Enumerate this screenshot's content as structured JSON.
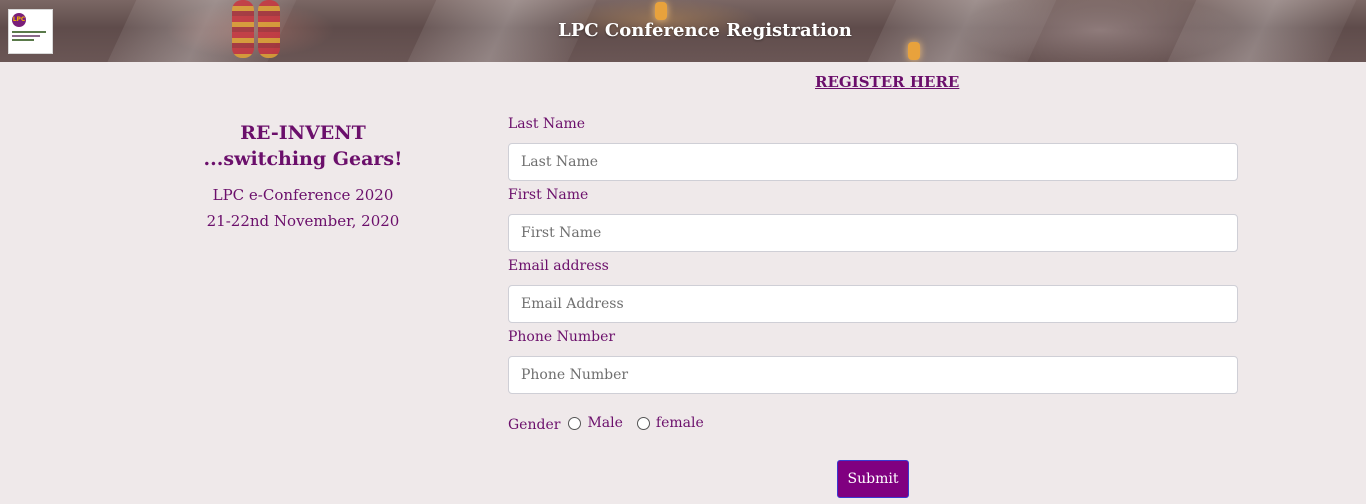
{
  "header": {
    "title": "LPC Conference Registration",
    "logo_text": "LPC"
  },
  "register_link": "REGISTER HERE",
  "info": {
    "tagline_1": "RE-INVENT",
    "tagline_2": "...switching Gears!",
    "conference": "LPC e-Conference 2020",
    "dates": "21-22nd November, 2020"
  },
  "form": {
    "last_name": {
      "label": "Last Name",
      "placeholder": "Last Name",
      "value": ""
    },
    "first_name": {
      "label": "First Name",
      "placeholder": "First Name",
      "value": ""
    },
    "email": {
      "label": "Email address",
      "placeholder": "Email Address",
      "value": ""
    },
    "phone": {
      "label": "Phone Number",
      "placeholder": "Phone Number",
      "value": ""
    },
    "gender": {
      "label": "Gender",
      "options": [
        "Male",
        "female"
      ]
    },
    "submit_label": "Submit"
  },
  "colors": {
    "accent": "#800080",
    "text": "#6b0f6b",
    "background": "#efe9ea"
  }
}
